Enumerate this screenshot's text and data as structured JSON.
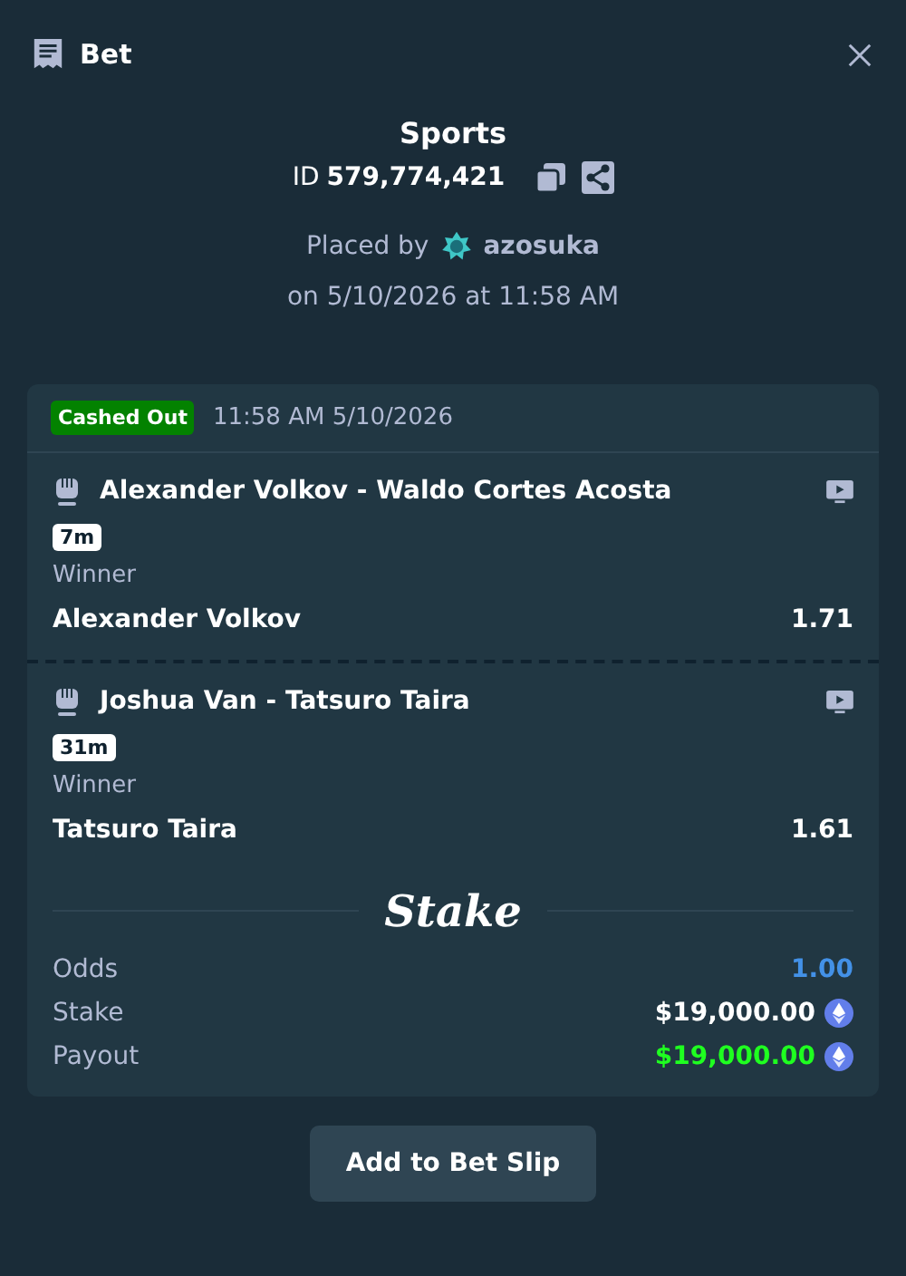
{
  "header": {
    "title": "Bet"
  },
  "bet": {
    "type": "Sports",
    "id_label": "ID",
    "id": "579,774,421",
    "placed_by_label": "Placed by",
    "user": "azosuka",
    "placed_on": "on 5/10/2026 at 11:58 AM"
  },
  "card": {
    "status": {
      "kind": "cashed_out",
      "label": "Cashed Out"
    },
    "time": "11:58 AM 5/10/2026",
    "legs": [
      {
        "event": "Alexander Volkov - Waldo Cortes Acosta",
        "badge": "7m",
        "market": "Winner",
        "selection": "Alexander Volkov",
        "odds": "1.71"
      },
      {
        "event": "Joshua Van - Tatsuro Taira",
        "badge": "31m",
        "market": "Winner",
        "selection": "Tatsuro Taira",
        "odds": "1.61"
      }
    ],
    "brand": "Stake",
    "summary": [
      {
        "kind": "odds",
        "label": "Odds",
        "value": "1.00"
      },
      {
        "kind": "stake",
        "label": "Stake",
        "value": "$19,000.00"
      },
      {
        "kind": "payout",
        "label": "Payout",
        "value": "$19,000.00"
      }
    ]
  },
  "button": "Add to Bet Slip"
}
